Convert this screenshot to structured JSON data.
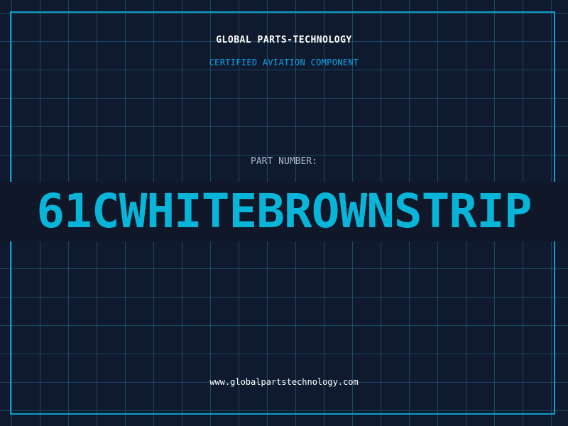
{
  "label": {
    "company": "GLOBAL PARTS-TECHNOLOGY",
    "subtitle": "CERTIFIED AVIATION COMPONENT",
    "part_number_label": "PART NUMBER:",
    "part_number": "61CWHITEBROWNSTRIP",
    "website": "www.globalpartstechnology.com"
  },
  "colors": {
    "background": "#101a2f",
    "grid": "#226e8c",
    "frame": "#0e9cc4",
    "accent": "#08b4d8",
    "text": "#ffffff",
    "muted": "#a9b6c9"
  }
}
